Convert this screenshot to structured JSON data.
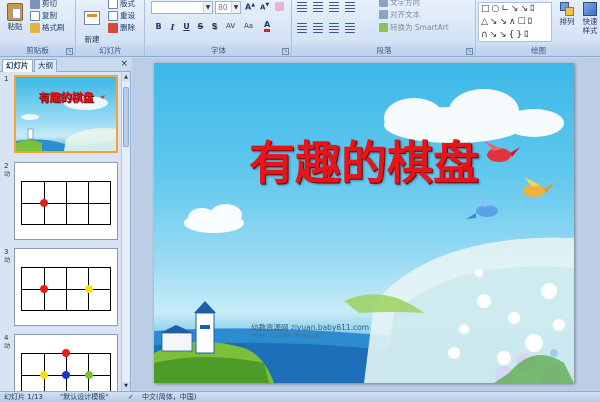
{
  "ribbon": {
    "clipboard": {
      "group_label": "剪贴板",
      "paste": "粘贴",
      "cut": "剪切",
      "copy": "复制",
      "format_painter": "格式刷"
    },
    "slides": {
      "group_label": "幻灯片",
      "new_slide": "新建\n幻灯片",
      "layout": "版式",
      "reset": "重设",
      "delete": "删除"
    },
    "font": {
      "group_label": "字体",
      "font_name": "",
      "font_size": "80",
      "bold": "B",
      "italic": "I",
      "underline": "U",
      "strike": "S",
      "shadow": "S"
    },
    "paragraph": {
      "group_label": "段落",
      "text_direction": "文字方向",
      "align_text": "对齐文本",
      "convert_smartart": "转换为 SmartArt"
    },
    "drawing": {
      "group_label": "绘图",
      "arrange": "排列",
      "quick_styles": "快速样式"
    }
  },
  "left_pane": {
    "tabs": [
      {
        "label": "幻灯片"
      },
      {
        "label": "大纲"
      }
    ],
    "close": "×",
    "thumbnails": [
      {
        "number": "1",
        "title": "有趣的棋盘"
      },
      {
        "number": "2",
        "icon": "动"
      },
      {
        "number": "3",
        "icon": "动"
      },
      {
        "number": "4",
        "icon": "动"
      }
    ]
  },
  "slide": {
    "title": "有趣的棋盘",
    "watermark": "幼教资源网 ziyuan.baby611.com",
    "watermark_small": "PPT课件、FLASH课件、教学资源下载..."
  },
  "status": {
    "slide_info": "幻灯片 1/13",
    "theme": "\"默认设计模板\"",
    "language": "中文(简体，中国)"
  },
  "colors": {
    "title_red": "#e4161c",
    "dot_red": "#e81c1c",
    "dot_yellow": "#f2e11a",
    "dot_blue": "#1436c8",
    "dot_green": "#7cc030",
    "selection_orange": "#f2a334"
  }
}
